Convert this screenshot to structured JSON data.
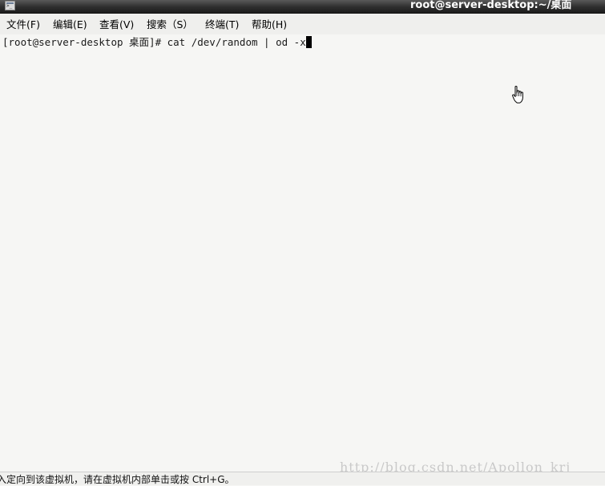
{
  "window": {
    "title": "root@server-desktop:~/桌面",
    "icon": "terminal-icon"
  },
  "menu": {
    "items": [
      {
        "label": "文件(F)"
      },
      {
        "label": "编辑(E)"
      },
      {
        "label": "查看(V)"
      },
      {
        "label": "搜索（S）"
      },
      {
        "label": "终端(T)"
      },
      {
        "label": "帮助(H)"
      }
    ]
  },
  "terminal": {
    "prompt": "[root@server-desktop 桌面]# ",
    "command": "cat /dev/random | od -x"
  },
  "pointer": {
    "icon": "hand-pointer-icon"
  },
  "status": {
    "text": "入定向到该虚拟机，请在虚拟机内部单击或按 Ctrl+G。"
  },
  "watermark": {
    "text": "http://blog.csdn.net/Apollon_krj"
  }
}
